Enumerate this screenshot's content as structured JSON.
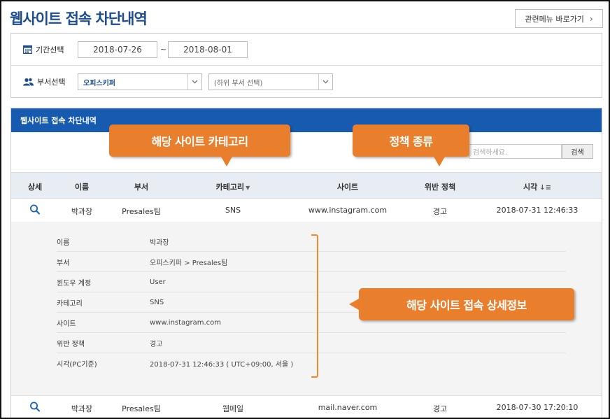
{
  "page": {
    "title": "웹사이트 접속 차단내역",
    "related_menu_label": "관련메뉴 바로가기"
  },
  "filters": {
    "period_label": "기간선택",
    "date_from": "2018-07-26",
    "date_to": "2018-08-01",
    "tilde": "~",
    "dept_label": "부서선택",
    "dept_selected": "오피스키퍼",
    "subdept_placeholder": "(하위 부서 선택)"
  },
  "panel": {
    "title": "웹사이트 접속 차단내역",
    "search_placeholder": "검색하세요.",
    "search_button": "검색"
  },
  "table": {
    "columns": {
      "detail": "상세",
      "name": "이름",
      "dept": "부서",
      "category": "카테고리",
      "site": "사이트",
      "policy": "위반 정책",
      "time": "시각"
    },
    "rows": [
      {
        "name": "박과장",
        "dept": "Presales팀",
        "category": "SNS",
        "site": "www.instagram.com",
        "policy": "경고",
        "time": "2018-07-31 12:46:33"
      },
      {
        "name": "박과장",
        "dept": "Presales팀",
        "category": "웹메일",
        "site": "mail.naver.com",
        "policy": "경고",
        "time": "2018-07-30 17:20:10"
      }
    ]
  },
  "detail": [
    {
      "key": "이름",
      "value": "박과장"
    },
    {
      "key": "부서",
      "value": "오피스키퍼 > Presales팀"
    },
    {
      "key": "윈도우 계정",
      "value": "User"
    },
    {
      "key": "카테고리",
      "value": "SNS"
    },
    {
      "key": "사이트",
      "value": "www.instagram.com"
    },
    {
      "key": "위반 정책",
      "value": "경고"
    },
    {
      "key": "시각(PC기준)",
      "value": "2018-07-31 12:46:33 ( UTC+09:00, 서울 )"
    }
  ],
  "callouts": {
    "category": "해당 사이트 카테고리",
    "policy": "정책 종류",
    "detail": "해당 사이트 접속 상세정보"
  },
  "colors": {
    "brand": "#165baf",
    "title": "#1d4d8f",
    "callout": "#e97e2c"
  }
}
